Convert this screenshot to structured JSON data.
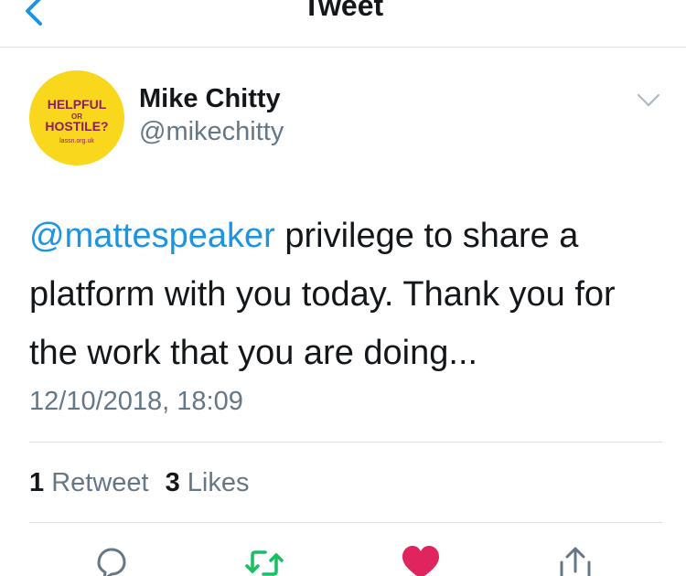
{
  "nav": {
    "title": "Tweet"
  },
  "avatar": {
    "line1": "HELPFUL",
    "line2": "OR",
    "line3": "HOSTILE?",
    "line4": "lassn.org.uk"
  },
  "author": {
    "name": "Mike Chitty",
    "handle": "@mikechitty"
  },
  "tweet": {
    "mention": "@mattespeaker",
    "line1_rest": " privilege to share a",
    "line2": "platform with you today. Thank you for",
    "line3": "the work that you are doing..."
  },
  "timestamp": "12/10/2018, 18:09",
  "stats": {
    "retweet_count": "1",
    "retweet_label": "Retweet",
    "like_count": "3",
    "like_label": "Likes"
  },
  "colors": {
    "accent": "#1b95e0",
    "retweet_green": "#17bf63",
    "like_red": "#e0245e",
    "avatar_yellow": "#f9d71c",
    "avatar_text": "#8e1e57",
    "muted": "#657786"
  },
  "icons": [
    "back-chevron-icon",
    "caret-down-icon",
    "reply-icon",
    "retweet-icon",
    "heart-icon",
    "share-icon"
  ]
}
